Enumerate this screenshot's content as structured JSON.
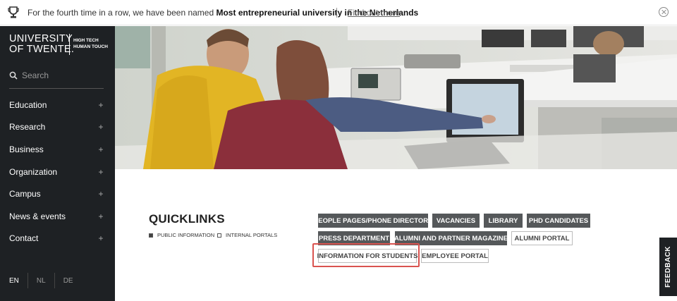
{
  "announcement": {
    "text_pre": "For the fourth time in a row, we have been named ",
    "text_bold": "Most entrepreneurial university in the Netherlands",
    "link": "Find out more"
  },
  "logo": {
    "line1": "UNIVERSITY",
    "line2": "OF TWENTE.",
    "tag1": "HIGH TECH",
    "tag2": "HUMAN TOUCH"
  },
  "search": {
    "placeholder": "Search"
  },
  "nav": {
    "items": [
      {
        "label": "Education",
        "icon": "+"
      },
      {
        "label": "Research",
        "icon": "+"
      },
      {
        "label": "Business",
        "icon": "+"
      },
      {
        "label": "Organization",
        "icon": "+"
      },
      {
        "label": "Campus",
        "icon": "+"
      },
      {
        "label": "News & events",
        "icon": "+"
      },
      {
        "label": "Contact",
        "icon": "+"
      }
    ]
  },
  "languages": [
    "EN",
    "NL",
    "DE"
  ],
  "quicklinks": {
    "title": "QUICKLINKS",
    "filters": [
      "PUBLIC INFORMATION",
      "INTERNAL PORTALS"
    ],
    "buttons": [
      "PEOPLE PAGES/PHONE DIRECTORY",
      "VACANCIES",
      "LIBRARY",
      "PHD CANDIDATES",
      "PRESS DEPARTMENT",
      "ALUMNI AND PARTNER MAGAZINE",
      "ALUMNI PORTAL",
      "INFORMATION FOR STUDENTS",
      "EMPLOYEE PORTAL"
    ]
  },
  "feedback": "FEEDBACK",
  "colors": {
    "sidebar": "#1e2124",
    "dark_button": "#55585a",
    "highlight": "#d9534f"
  }
}
